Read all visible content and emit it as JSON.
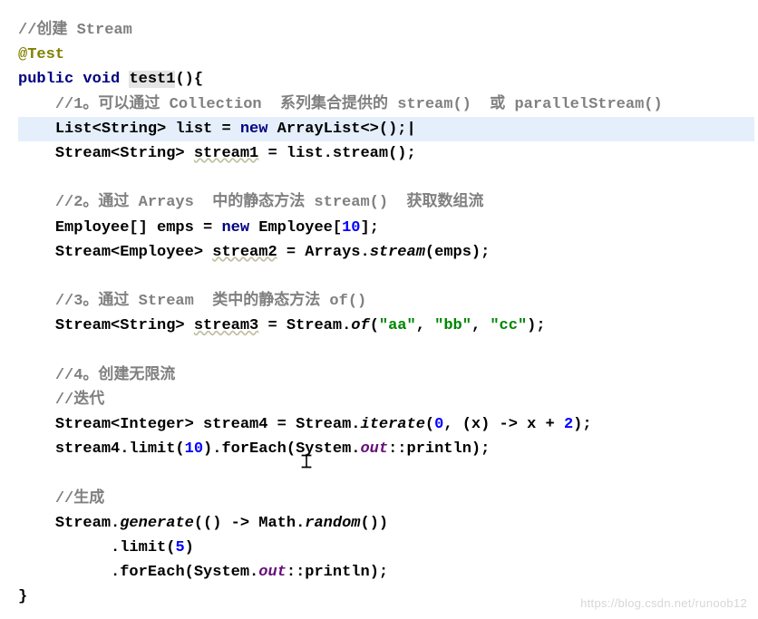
{
  "code": {
    "l1_comment": "//创建 Stream",
    "l2_annotation": "@Test",
    "l3_public": "public",
    "l3_void": "void",
    "l3_method": "test1",
    "l3_rest": "(){",
    "l4_comment_a": "//1。可以通过 Collection  系列集合提供的 stream()  或 parallelStream()",
    "l5_type_a": "List<String> ",
    "l5_var": "list",
    "l5_eq": " = ",
    "l5_new": "new",
    "l5_rest": " ArrayList<>();",
    "l6_type": "Stream<String> ",
    "l6_var": "stream1",
    "l6_rest": " = list.stream();",
    "l8_comment": "//2。通过 Arrays  中的静态方法 stream()  获取数组流",
    "l9_type": "Employee[] emps = ",
    "l9_new": "new",
    "l9_rest": " Employee[",
    "l9_num": "10",
    "l9_end": "];",
    "l10_type": "Stream<Employee> ",
    "l10_var": "stream2",
    "l10_rest": " = Arrays.",
    "l10_m": "stream",
    "l10_end": "(emps);",
    "l12_comment": "//3。通过 Stream  类中的静态方法 of()",
    "l13_type": "Stream<String> ",
    "l13_var": "stream3",
    "l13_rest": " = Stream.",
    "l13_m": "of",
    "l13_p1": "(",
    "l13_s1": "\"aa\"",
    "l13_c1": ", ",
    "l13_s2": "\"bb\"",
    "l13_c2": ", ",
    "l13_s3": "\"cc\"",
    "l13_end": ");",
    "l15_comment": "//4。创建无限流",
    "l16_comment": "//迭代",
    "l17_type": "Stream<Integer> ",
    "l17_var": "stream4",
    "l17_rest": " = Stream.",
    "l17_m": "iterate",
    "l17_p1": "(",
    "l17_n1": "0",
    "l17_c1": ", (x) -> x + ",
    "l17_n2": "2",
    "l17_end": ");",
    "l18_a": "stream4.limit(",
    "l18_n": "10",
    "l18_b": ").forEach(System.",
    "l18_out": "out",
    "l18_c": "::println);",
    "l20_comment": "//生成",
    "l21_a": "Stream.",
    "l21_m": "generate",
    "l21_b": "(() -> Math.",
    "l21_m2": "random",
    "l21_c": "())",
    "l22_a": ".limit(",
    "l22_n": "5",
    "l22_b": ")",
    "l23_a": ".forEach(System.",
    "l23_out": "out",
    "l23_b": "::println);",
    "l24": "}"
  },
  "watermark": "https://blog.csdn.net/runoob12"
}
